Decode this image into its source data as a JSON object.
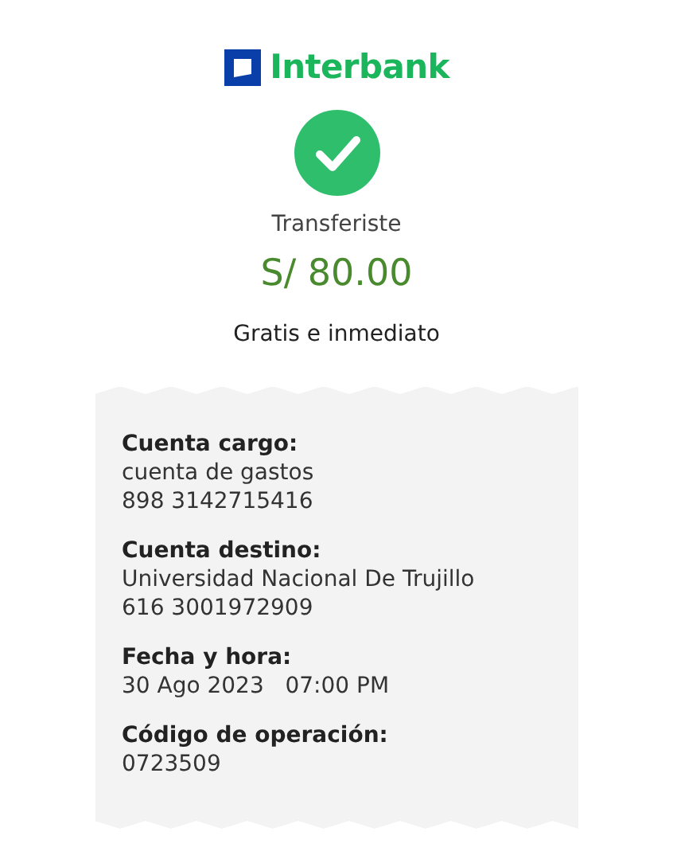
{
  "logo": {
    "text": "Interbank"
  },
  "status": {
    "label": "Transferiste",
    "amount": "S/ 80.00",
    "note": "Gratis e inmediato"
  },
  "details": [
    {
      "label": "Cuenta cargo:",
      "lines": [
        "cuenta de gastos",
        "898 3142715416"
      ]
    },
    {
      "label": "Cuenta destino:",
      "lines": [
        "Universidad Nacional De Trujillo",
        "616 3001972909"
      ]
    },
    {
      "label": "Fecha y hora:",
      "lines": [
        "30 Ago 2023   07:00 PM"
      ]
    },
    {
      "label": "Código de operación:",
      "lines": [
        "0723509"
      ]
    }
  ]
}
